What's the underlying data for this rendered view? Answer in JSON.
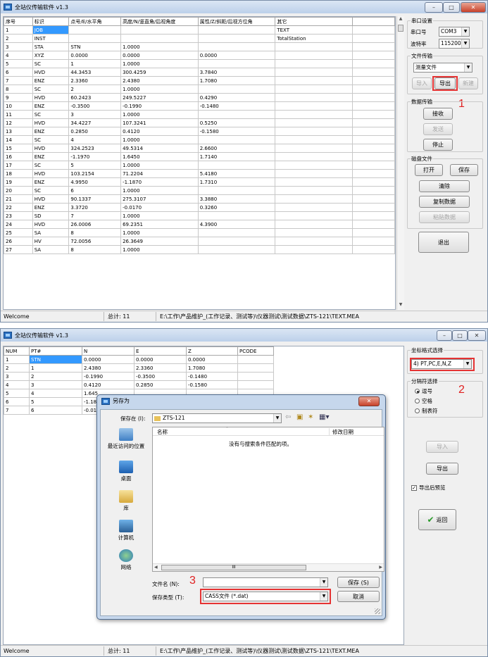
{
  "window1": {
    "title": "全站仪传输软件 v1.3",
    "columns": [
      "序号",
      "标识",
      "点号/E/水平角",
      "高度/N/竖直角/后视角度",
      "属性/Z/斜距/后视方位角",
      "其它"
    ],
    "rows": [
      [
        "1",
        "JOB",
        "",
        "",
        "",
        "TEXT"
      ],
      [
        "2",
        "INST",
        "",
        "",
        "",
        "TotalStation"
      ],
      [
        "3",
        "STA",
        "STN",
        "1.0000",
        "",
        ""
      ],
      [
        "4",
        "XYZ",
        "0.0000",
        "0.0000",
        "0.0000",
        ""
      ],
      [
        "5",
        "SC",
        "1",
        "1.0000",
        "",
        ""
      ],
      [
        "6",
        "HVD",
        "44.3453",
        "300.4259",
        "3.7840",
        ""
      ],
      [
        "7",
        "ENZ",
        "2.3360",
        "2.4380",
        "1.7080",
        ""
      ],
      [
        "8",
        "SC",
        "2",
        "1.0000",
        "",
        ""
      ],
      [
        "9",
        "HVD",
        "60.2423",
        "249.5227",
        "0.4290",
        ""
      ],
      [
        "10",
        "ENZ",
        "-0.3500",
        "-0.1990",
        "-0.1480",
        ""
      ],
      [
        "11",
        "SC",
        "3",
        "1.0000",
        "",
        ""
      ],
      [
        "12",
        "HVD",
        "34.4227",
        "107.3241",
        "0.5250",
        ""
      ],
      [
        "13",
        "ENZ",
        "0.2850",
        "0.4120",
        "-0.1580",
        ""
      ],
      [
        "14",
        "SC",
        "4",
        "1.0000",
        "",
        ""
      ],
      [
        "15",
        "HVD",
        "324.2523",
        "49.5314",
        "2.6600",
        ""
      ],
      [
        "16",
        "ENZ",
        "-1.1970",
        "1.6450",
        "1.7140",
        ""
      ],
      [
        "17",
        "SC",
        "5",
        "1.0000",
        "",
        ""
      ],
      [
        "18",
        "HVD",
        "103.2154",
        "71.2204",
        "5.4180",
        ""
      ],
      [
        "19",
        "ENZ",
        "4.9950",
        "-1.1870",
        "1.7310",
        ""
      ],
      [
        "20",
        "SC",
        "6",
        "1.0000",
        "",
        ""
      ],
      [
        "21",
        "HVD",
        "90.1337",
        "275.3107",
        "3.3880",
        ""
      ],
      [
        "22",
        "ENZ",
        "3.3720",
        "-0.0170",
        "0.3260",
        ""
      ],
      [
        "23",
        "SD",
        "7",
        "1.0000",
        "",
        ""
      ],
      [
        "24",
        "HVD",
        "26.0006",
        "69.2351",
        "4.3900",
        ""
      ],
      [
        "25",
        "SA",
        "8",
        "1.0000",
        "",
        ""
      ],
      [
        "26",
        "HV",
        "72.0056",
        "26.3649",
        "",
        ""
      ],
      [
        "27",
        "SA",
        "8",
        "1.0000",
        "",
        ""
      ]
    ],
    "panel": {
      "serial_group": "串口设置",
      "port_label": "串口号",
      "port_value": "COM3",
      "baud_label": "波特率",
      "baud_value": "115200",
      "file_group": "文件传输",
      "file_type": "测量文件",
      "import_btn": "导入",
      "export_btn": "导出",
      "new_btn": "新建",
      "data_group": "数据传输",
      "receive_btn": "接收",
      "send_btn": "发送",
      "stop_btn": "停止",
      "disk_group": "磁盘文件",
      "open_btn": "打开",
      "save_btn": "保存",
      "clear_btn": "清除",
      "copy_btn": "复制数据",
      "paste_btn": "粘贴数据",
      "exit_btn": "退出"
    },
    "annotation": "1",
    "status": {
      "welcome": "Welcome",
      "total": "总计: 11",
      "path": "E:\\工作\\产品维护_(工作记录、测试等)\\仪器测试\\测试数据\\ZTS-121\\TEXT.MEA"
    }
  },
  "window2": {
    "title": "全站仪传输软件 v1.3",
    "columns": [
      "NUM",
      "PT#",
      "N",
      "E",
      "Z",
      "PCODE"
    ],
    "rows": [
      [
        "1",
        "STN",
        "0.0000",
        "0.0000",
        "0.0000",
        ""
      ],
      [
        "2",
        "1",
        "2.4380",
        "2.3360",
        "1.7080",
        ""
      ],
      [
        "3",
        "2",
        "-0.1990",
        "-0.3500",
        "-0.1480",
        ""
      ],
      [
        "4",
        "3",
        "0.4120",
        "0.2850",
        "-0.1580",
        ""
      ],
      [
        "5",
        "4",
        "1.645",
        "",
        "",
        ""
      ],
      [
        "6",
        "5",
        "-1.18",
        "",
        "",
        ""
      ],
      [
        "7",
        "6",
        "-0.01",
        "",
        "",
        ""
      ]
    ],
    "panel": {
      "coord_group": "坐标格式选择",
      "coord_value": "4) PT,PC,E,N,Z",
      "sep_group": "分隔符选择",
      "sep_comma": "逗号",
      "sep_space": "空格",
      "sep_tab": "制表符",
      "import_btn": "导入",
      "export_btn": "导出",
      "preview_chk": "导出后预览",
      "back_btn": "返回"
    },
    "annotation2": "2",
    "annotation3": "3",
    "dialog": {
      "title": "另存为",
      "save_in_label": "保存在 (I):",
      "folder": "ZTS-121",
      "col_name": "名称",
      "col_date": "修改日期",
      "empty_msg": "没有与搜索条件匹配的项。",
      "places": [
        "最近访问的位置",
        "桌面",
        "库",
        "计算机",
        "网络"
      ],
      "filename_label": "文件名 (N):",
      "filename_value": "",
      "filetype_label": "保存类型 (T):",
      "filetype_value": "CASS文件 (*.dat)",
      "save_btn": "保存 (S)",
      "cancel_btn": "取消",
      "scroll_label": "III"
    },
    "status": {
      "welcome": "Welcome",
      "total": "总计: 11",
      "path": "E:\\工作\\产品维护_(工作记录、测试等)\\仪器测试\\测试数据\\ZTS-121\\TEXT.MEA"
    }
  },
  "colors": {
    "selection": "#3399ff",
    "annotation": "#e53333"
  }
}
